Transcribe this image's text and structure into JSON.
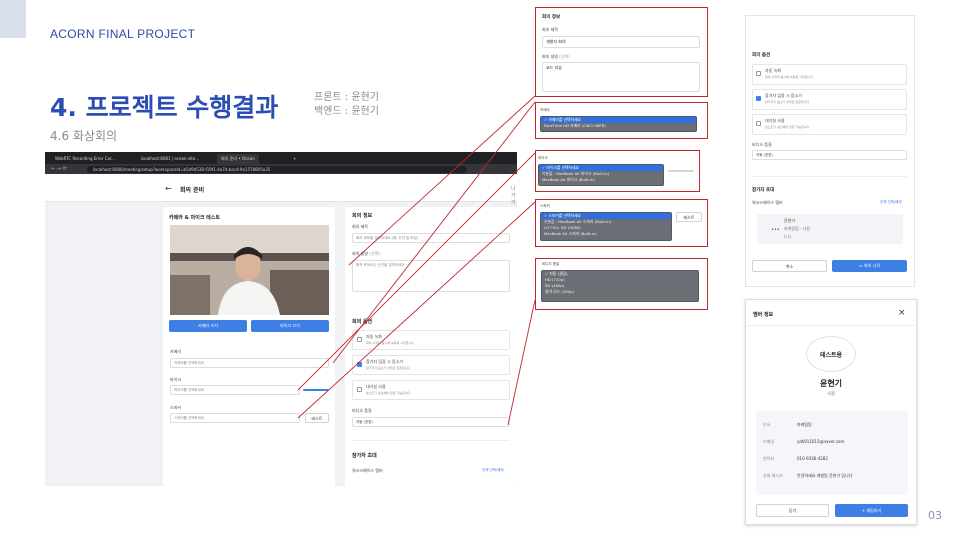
{
  "slide": {
    "project": "ACORN FINAL PROJECT",
    "title": "4. 프로젝트 수행결과",
    "roles": [
      "프론트 : 윤현기",
      "백엔드 : 윤현기"
    ],
    "subsection": "4.6 화상회의",
    "page": "03"
  },
  "browser": {
    "tabs": [
      "WebRTC Recording Error Cor...",
      "localhost:8081 | ocean-vite...",
      "회의 준비 • Ocean"
    ],
    "new_tab": "+",
    "url": "localhost:8080/meeting/setup?workspaceId=b5d9d538-f19f1-4a7d-bacd-9e1578805a35"
  },
  "app": {
    "back_label": "←",
    "title": "회의 준비",
    "exit": "나가기",
    "device_card": {
      "title": "카메라 & 마이크 테스트",
      "camera_off": "카메라 끄기",
      "mic_off": "마이크 끄기",
      "camera_label": "카메라",
      "camera_value": "카메라를 선택하세요",
      "mic_label": "마이크",
      "mic_value": "마이크를 선택하세요",
      "speaker_label": "스피커",
      "speaker_value": "스피커를 선택하세요",
      "test": "테스트"
    },
    "info_card": {
      "title": "회의 정보",
      "meeting_title_label": "회의 제목",
      "meeting_title_placeholder": "회의 제목을 입력하세요 (예: 주간 팀 미팅)",
      "meeting_desc_label": "회의 설명",
      "meeting_desc_optional": "(선택)",
      "meeting_desc_placeholder": "회의 목적이나 안건을 입력하세요",
      "options_title": "회의 옵션",
      "opt_record": "자동 녹화",
      "opt_record_desc": "회의 시작과 동시에 녹화를 시작합니다",
      "opt_mute": "참가자 입장 시 음소거",
      "opt_mute_desc": "참가자가 음소거 상태로 입장합니다",
      "opt_wait": "대기실 사용",
      "opt_wait_desc": "호스트가 승인해야 입장 가능합니다",
      "quality_label": "비디오 품질",
      "quality_value": "자동 (권장)",
      "invite_title": "참가자 초대",
      "workspace_member": "워크스페이스 멤버",
      "select_all": "전체 선택/해제"
    }
  },
  "zoom": {
    "info": {
      "title": "회의 정보",
      "meeting_title_label": "회의 제목",
      "meeting_title_value": "개발자 회의",
      "meeting_desc_label": "회의 설명",
      "meeting_desc_optional": "(선택)",
      "meeting_desc_value": "코드 리뷰"
    },
    "camera": {
      "label": "카메라",
      "items": [
        "✓ 카메라를 선택하세요",
        "FaceTime HD 카메라 (C4E1:9BFB)"
      ]
    },
    "mic": {
      "label": "마이크",
      "items": [
        "✓ 마이크를 선택하세요",
        "기본값 - MacBook Air 마이크 (Built-in)",
        "MacBook Air 마이크 (Built-in)"
      ]
    },
    "speaker": {
      "label": "스피커",
      "items": [
        "✓ 스피커를 선택하세요",
        "기본값 - MacBook Air 스피커 (Built-in)",
        "LG FULL HD (HDMI)",
        "MacBook Air 스피커 (Built-in)"
      ],
      "test": "테스트"
    },
    "quality": {
      "label": "비디오 품질",
      "items": [
        "✓ 자동 (권장)",
        "HD (720p)",
        "SD (480p)",
        "절약 모드 (360p)"
      ]
    }
  },
  "options_panel": {
    "title": "회의 옵션",
    "opt_record": "자동 녹화",
    "opt_record_desc": "회의 시작과 동시에 녹화를 시작합니다",
    "opt_mute": "참가자 입장 시 음소거",
    "opt_mute_desc": "참가자가 음소거 상태로 입장합니다",
    "opt_wait": "대기실 사용",
    "opt_wait_desc": "호스트가 승인해야 입장 가능합니다",
    "quality_label": "비디오 품질",
    "quality_value": "자동 (권장)",
    "invite_title": "참가자 초대",
    "workspace_member": "워크스페이스 멤버",
    "select_all": "전체 선택/해제",
    "member_name": "윤현기",
    "member_dept": "마케팅팀 · 사원",
    "member_tag": "(나)",
    "cancel": "취소",
    "start": "회의 시작"
  },
  "member_modal": {
    "title": "멤버 정보",
    "close": "×",
    "team": "테스트용",
    "name": "윤현기",
    "position": "사원",
    "rows": [
      {
        "key": "부서",
        "value": "마케팅팀"
      },
      {
        "key": "이메일",
        "value": "ydk911015@naver.com"
      },
      {
        "key": "연락처",
        "value": "010-9336-4282"
      },
      {
        "key": "상태 메시지",
        "value": "안녕하세요 개발팀 윤현기 입니다"
      }
    ],
    "close_btn": "닫기",
    "chat_btn": "+ 채팅하기"
  },
  "colors": {
    "accent": "#2c4db2",
    "highlight": "#c0272d",
    "primary_button": "#3e7fe6"
  }
}
